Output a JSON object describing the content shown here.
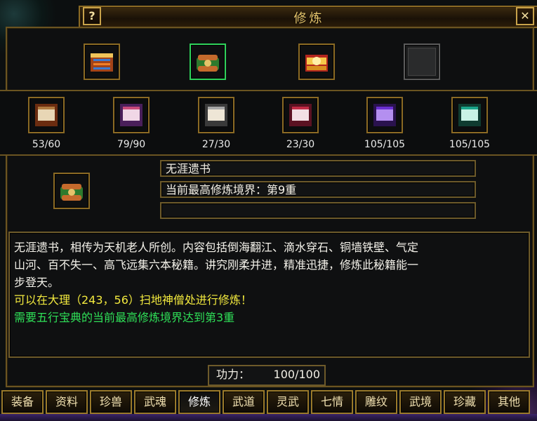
{
  "window": {
    "title": "修炼",
    "help_label": "?",
    "close_label": "✕"
  },
  "top_slots": [
    {
      "icon": "book-icon",
      "selected": false
    },
    {
      "icon": "scroll-bundle-icon",
      "selected": true
    },
    {
      "icon": "treasure-chest-icon",
      "selected": false
    },
    {
      "icon": "empty-slot",
      "selected": false
    }
  ],
  "scrolls": [
    {
      "icon": "scroll-brown-icon",
      "count": "53/60"
    },
    {
      "icon": "scroll-purple-icon",
      "count": "79/90"
    },
    {
      "icon": "scroll-grey-icon",
      "count": "27/30"
    },
    {
      "icon": "scroll-red-icon",
      "count": "23/30"
    },
    {
      "icon": "scroll-violet-icon",
      "count": "105/105"
    },
    {
      "icon": "scroll-teal-icon",
      "count": "105/105"
    }
  ],
  "selected_item": {
    "icon": "scroll-bundle-icon",
    "name": "无涯遗书",
    "realm": "当前最高修炼境界：第9重",
    "extra": ""
  },
  "description": {
    "line1": "无涯遗书，相传为天机老人所创。内容包括倒海翻江、滴水穿石、铜墙铁壁、气定",
    "line2": "山河、百不失一、高飞远集六本秘籍。讲究刚柔并进，精准迅捷，修炼此秘籍能一",
    "line3": "步登天。",
    "location": "可以在大理（243，56）扫地神僧处进行修炼！",
    "requirement": "需要五行宝典的当前最高修炼境界达到第3重"
  },
  "power": {
    "label": "功力：",
    "value": "100/100"
  },
  "tabs": [
    {
      "label": "装备",
      "active": false
    },
    {
      "label": "资料",
      "active": false
    },
    {
      "label": "珍兽",
      "active": false
    },
    {
      "label": "武魂",
      "active": false
    },
    {
      "label": "修炼",
      "active": true
    },
    {
      "label": "武道",
      "active": false
    },
    {
      "label": "灵武",
      "active": false
    },
    {
      "label": "七情",
      "active": false
    },
    {
      "label": "雕纹",
      "active": false
    },
    {
      "label": "武境",
      "active": false
    },
    {
      "label": "珍藏",
      "active": false
    },
    {
      "label": "其他",
      "active": false
    }
  ],
  "colors": {
    "accent": "#8a6a24",
    "title": "#e7c66c",
    "location_text": "#f2e93e",
    "requirement_text": "#2fe058",
    "selected_border": "#2fd15a"
  }
}
